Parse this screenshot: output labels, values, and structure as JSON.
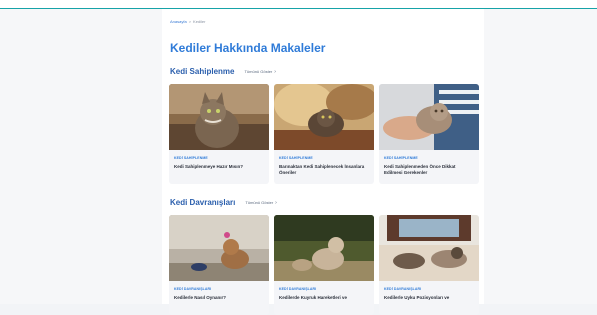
{
  "breadcrumb": {
    "home": "Anasayfa",
    "separator": ">",
    "current": "Kediler"
  },
  "page_title": "Kediler Hakkında Makaleler",
  "sections": [
    {
      "title": "Kedi Sahiplenme",
      "see_all": "Tümünü Göster",
      "see_all_icon": "chevron-right-icon",
      "cards": [
        {
          "category": "KEDİ SAHİPLENME",
          "title": "Kedi Sahiplenmeye Hazır Mısın?"
        },
        {
          "category": "KEDİ SAHİPLENME",
          "title": "Barınaktan Kedi Sahiplenecek İnsanlara Öneriler"
        },
        {
          "category": "KEDİ SAHİPLENME",
          "title": "Kedi Sahiplenmeden Önce Dikkat Edilmesi Gerekenler"
        }
      ]
    },
    {
      "title": "Kedi Davranışları",
      "see_all": "Tümünü Göster",
      "see_all_icon": "chevron-right-icon",
      "cards": [
        {
          "category": "KEDİ DAVRANIŞLARI",
          "title": "Kedilerle Nasıl Oynanır?"
        },
        {
          "category": "KEDİ DAVRANIŞLARI",
          "title": "Kedilerde Kuyruk Hareketleri ve"
        },
        {
          "category": "KEDİ DAVRANIŞLARI",
          "title": "Kedilerle Uyku Pozisyonları ve"
        }
      ]
    }
  ],
  "colors": {
    "accent": "#2f7bd8",
    "section_title": "#2b5fad",
    "topbar_line": "#16a3a8"
  }
}
